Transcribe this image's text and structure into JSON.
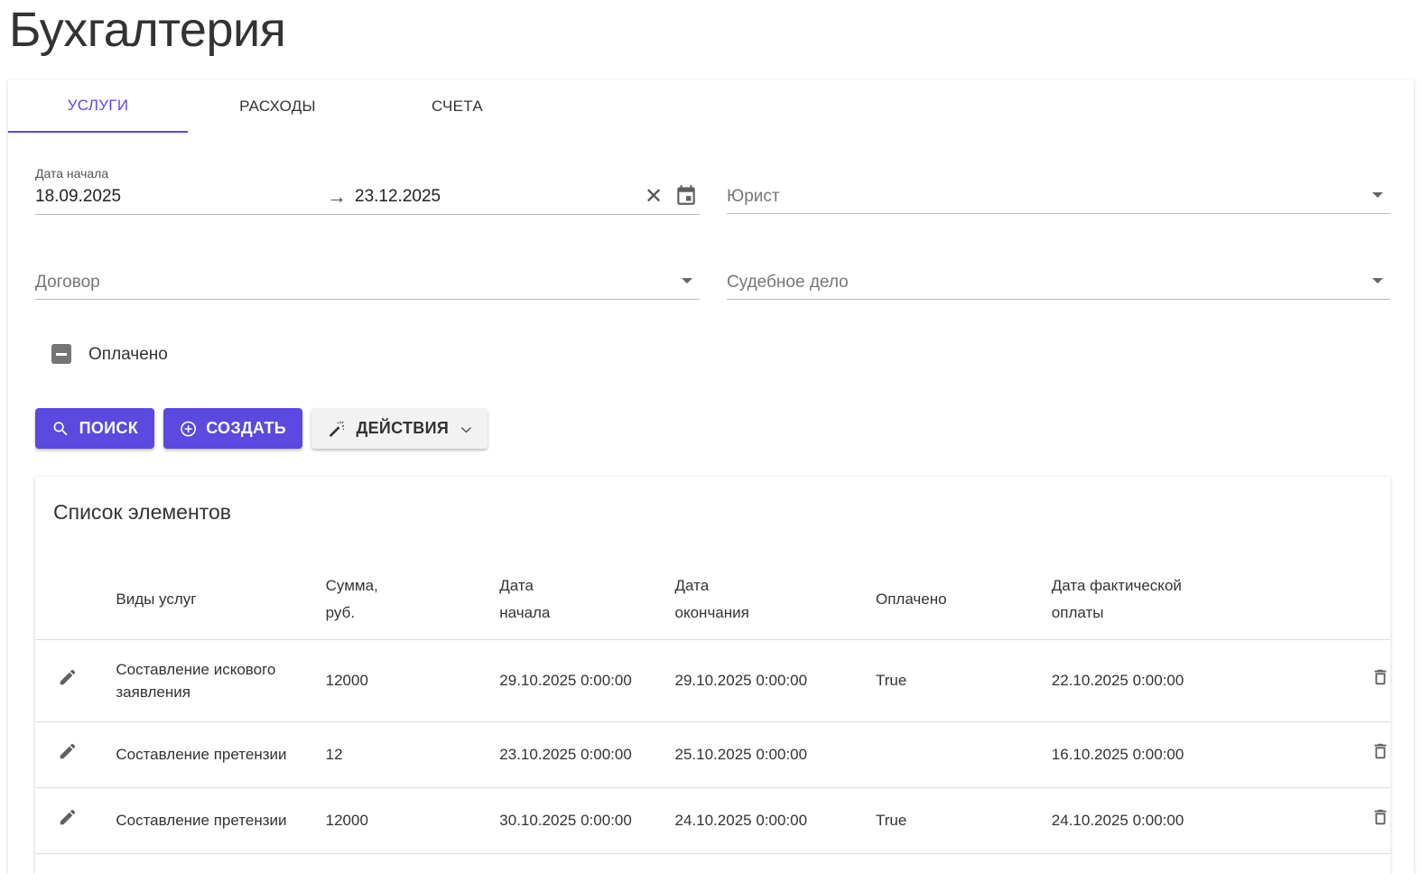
{
  "page_title": "Бухгалтерия",
  "tabs": [
    {
      "label": "УСЛУГИ",
      "active": true
    },
    {
      "label": "РАСХОДЫ"
    },
    {
      "label": "СЧЕТА"
    }
  ],
  "filters": {
    "date_label": "Дата начала",
    "date_from": "18.09.2025",
    "date_to": "23.12.2025",
    "lawyer_placeholder": "Юрист",
    "contract_placeholder": "Договор",
    "case_placeholder": "Судебное дело",
    "paid_label": "Оплачено",
    "paid_state": "indeterminate"
  },
  "buttons": {
    "search": "ПОИСК",
    "create": "СОЗДАТЬ",
    "actions": "ДЕЙСТВИЯ"
  },
  "colors": {
    "accent": "#5b49e0"
  },
  "list": {
    "title": "Список элементов",
    "headers": {
      "service": "Виды услуг",
      "sum1": "Сумма,",
      "sum2": "руб.",
      "start1": "Дата",
      "start2": "начала",
      "end1": "Дата",
      "end2": "окончания",
      "paid": "Оплачено",
      "paydate1": "Дата фактической",
      "paydate2": "оплаты"
    },
    "rows": [
      {
        "service": "Составление искового заявления",
        "sum": "12000",
        "start": "29.10.2025 0:00:00",
        "end": "29.10.2025 0:00:00",
        "paid": "True",
        "paydate": "22.10.2025 0:00:00"
      },
      {
        "service": "Составление претензии",
        "sum": "12",
        "start": "23.10.2025 0:00:00",
        "end": "25.10.2025 0:00:00",
        "paid": "",
        "paydate": "16.10.2025 0:00:00"
      },
      {
        "service": "Составление претензии",
        "sum": "12000",
        "start": "30.10.2025 0:00:00",
        "end": "24.10.2025 0:00:00",
        "paid": "True",
        "paydate": "24.10.2025 0:00:00"
      }
    ]
  }
}
